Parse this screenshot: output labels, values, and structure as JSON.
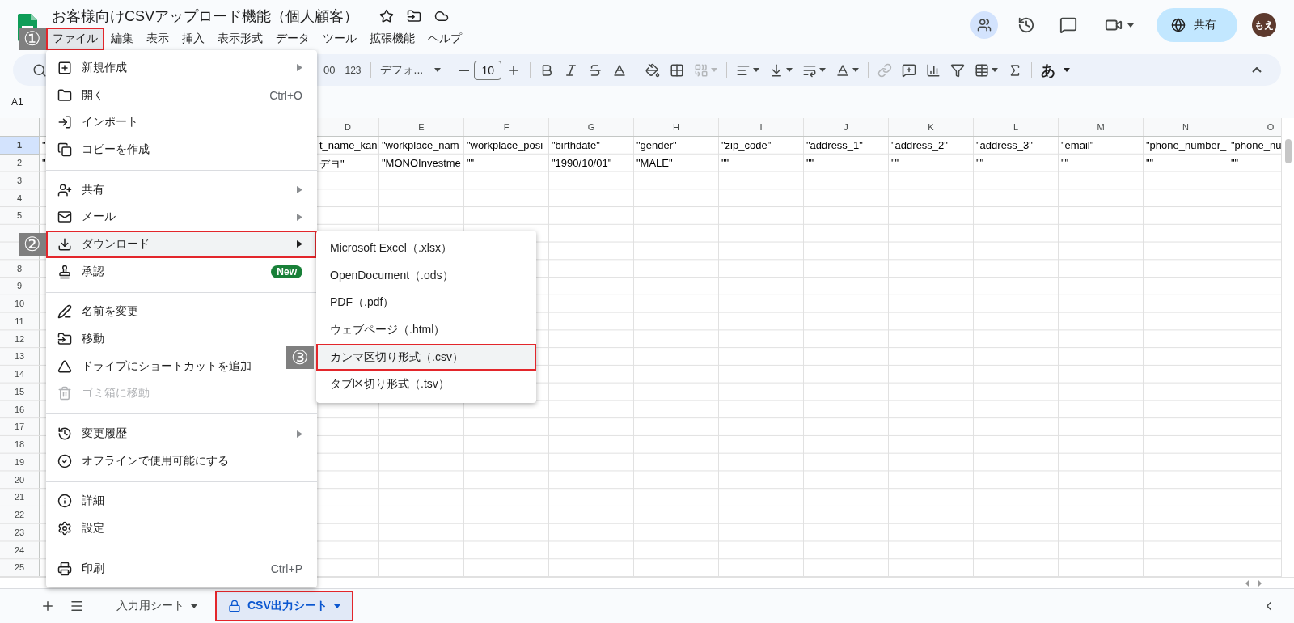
{
  "document": {
    "title": "お客様向けCSVアップロード機能（個人顧客）"
  },
  "menubar": [
    {
      "label": "ファイル",
      "selected": true,
      "highlighted": true,
      "step": "①"
    },
    {
      "label": "編集",
      "selected": false,
      "highlighted": false
    },
    {
      "label": "表示",
      "selected": false,
      "highlighted": false
    },
    {
      "label": "挿入",
      "selected": false,
      "highlighted": false
    },
    {
      "label": "表示形式",
      "selected": false,
      "highlighted": false
    },
    {
      "label": "データ",
      "selected": false,
      "highlighted": false
    },
    {
      "label": "ツール",
      "selected": false,
      "highlighted": false
    },
    {
      "label": "拡張機能",
      "selected": false,
      "highlighted": false
    },
    {
      "label": "ヘルプ",
      "selected": false,
      "highlighted": false
    }
  ],
  "header_actions": {
    "share": "共有",
    "avatar": "もえ"
  },
  "toolbar": {
    "decimal": "00",
    "number_format": "123",
    "font": "デフォ...",
    "font_size": "10",
    "input_tool": "あ"
  },
  "name_box": "A1",
  "grid": {
    "columns": [
      "D",
      "E",
      "F",
      "G",
      "H",
      "I",
      "J",
      "K",
      "L",
      "M",
      "N",
      "O"
    ],
    "rows": [
      {
        "number": "1",
        "selected": true,
        "column_a": "\"",
        "cells": [
          "t_name_kan",
          "\"workplace_nam",
          "\"workplace_posi",
          "\"birthdate\"",
          "\"gender\"",
          "\"zip_code\"",
          "\"address_1\"",
          "\"address_2\"",
          "\"address_3\"",
          "\"email\"",
          "\"phone_number_",
          "\"phone_nu"
        ]
      },
      {
        "number": "2",
        "selected": false,
        "column_a": "\"",
        "cells": [
          "デヨ\"",
          "\"MONOInvestme",
          "\"\"",
          "\"1990/10/01\"",
          "\"MALE\"",
          "\"\"",
          "\"\"",
          "\"\"",
          "\"\"",
          "\"\"",
          "\"\"",
          "\"\""
        ]
      },
      {
        "number": "3",
        "selected": false
      },
      {
        "number": "4",
        "selected": false
      },
      {
        "number": "5",
        "selected": false
      },
      {
        "selected": false
      },
      {
        "selected": false
      },
      {
        "number": "8",
        "selected": false
      },
      {
        "number": "9",
        "selected": false
      },
      {
        "number": "10",
        "selected": false
      },
      {
        "number": "11",
        "selected": false
      },
      {
        "number": "12",
        "selected": false
      },
      {
        "number": "13",
        "selected": false
      },
      {
        "number": "14",
        "selected": false
      },
      {
        "number": "15",
        "selected": false
      },
      {
        "number": "16",
        "selected": false
      },
      {
        "number": "17",
        "selected": false
      },
      {
        "number": "18",
        "selected": false
      },
      {
        "number": "19",
        "selected": false
      },
      {
        "number": "20",
        "selected": false
      },
      {
        "number": "21",
        "selected": false
      },
      {
        "number": "22",
        "selected": false
      },
      {
        "number": "23",
        "selected": false
      },
      {
        "number": "24",
        "selected": false
      },
      {
        "number": "25",
        "selected": false
      }
    ]
  },
  "file_menu": {
    "groups": [
      [
        {
          "label": "新規作成",
          "submenu": true,
          "disabled": false,
          "selected": false,
          "highlighted": false
        },
        {
          "label": "開く",
          "shortcut": "Ctrl+O",
          "submenu": false,
          "disabled": false,
          "selected": false,
          "highlighted": false
        },
        {
          "label": "インポート",
          "submenu": false,
          "disabled": false,
          "selected": false,
          "highlighted": false
        },
        {
          "label": "コピーを作成",
          "submenu": false,
          "disabled": false,
          "selected": false,
          "highlighted": false
        }
      ],
      [
        {
          "label": "共有",
          "submenu": true,
          "disabled": false,
          "selected": false,
          "highlighted": false
        },
        {
          "label": "メール",
          "submenu": true,
          "disabled": false,
          "selected": false,
          "highlighted": false
        },
        {
          "label": "ダウンロード",
          "submenu": true,
          "disabled": false,
          "selected": true,
          "highlighted": true,
          "step": "②"
        },
        {
          "label": "承認",
          "badge": "New",
          "submenu": false,
          "disabled": false,
          "selected": false,
          "highlighted": false
        }
      ],
      [
        {
          "label": "名前を変更",
          "submenu": false,
          "disabled": false,
          "selected": false,
          "highlighted": false
        },
        {
          "label": "移動",
          "submenu": false,
          "disabled": false,
          "selected": false,
          "highlighted": false
        },
        {
          "label": "ドライブにショートカットを追加",
          "submenu": false,
          "disabled": false,
          "selected": false,
          "highlighted": false
        },
        {
          "label": "ゴミ箱に移動",
          "submenu": false,
          "disabled": true,
          "selected": false,
          "highlighted": false
        }
      ],
      [
        {
          "label": "変更履歴",
          "submenu": true,
          "disabled": false,
          "selected": false,
          "highlighted": false
        },
        {
          "label": "オフラインで使用可能にする",
          "submenu": false,
          "disabled": false,
          "selected": false,
          "highlighted": false
        }
      ],
      [
        {
          "label": "詳細",
          "submenu": false,
          "disabled": false,
          "selected": false,
          "highlighted": false
        },
        {
          "label": "設定",
          "submenu": false,
          "disabled": false,
          "selected": false,
          "highlighted": false
        }
      ],
      [
        {
          "label": "印刷",
          "shortcut": "Ctrl+P",
          "submenu": false,
          "disabled": false,
          "selected": false,
          "highlighted": false
        }
      ]
    ]
  },
  "download_submenu": {
    "items": [
      {
        "label": "Microsoft Excel（.xlsx）",
        "selected": false,
        "highlighted": false
      },
      {
        "label": "OpenDocument（.ods）",
        "selected": false,
        "highlighted": false
      },
      {
        "label": "PDF（.pdf）",
        "selected": false,
        "highlighted": false
      },
      {
        "label": "ウェブページ（.html）",
        "selected": false,
        "highlighted": false
      },
      {
        "label": "カンマ区切り形式（.csv）",
        "selected": true,
        "highlighted": true,
        "step": "③"
      },
      {
        "label": "タブ区切り形式（.tsv）",
        "selected": false,
        "highlighted": false
      }
    ]
  },
  "sheet_tabs": [
    {
      "label": "入力用シート",
      "selected": false,
      "locked": false,
      "highlighted": false
    },
    {
      "label": "CSV出力シート",
      "selected": true,
      "locked": true,
      "highlighted": true
    }
  ]
}
